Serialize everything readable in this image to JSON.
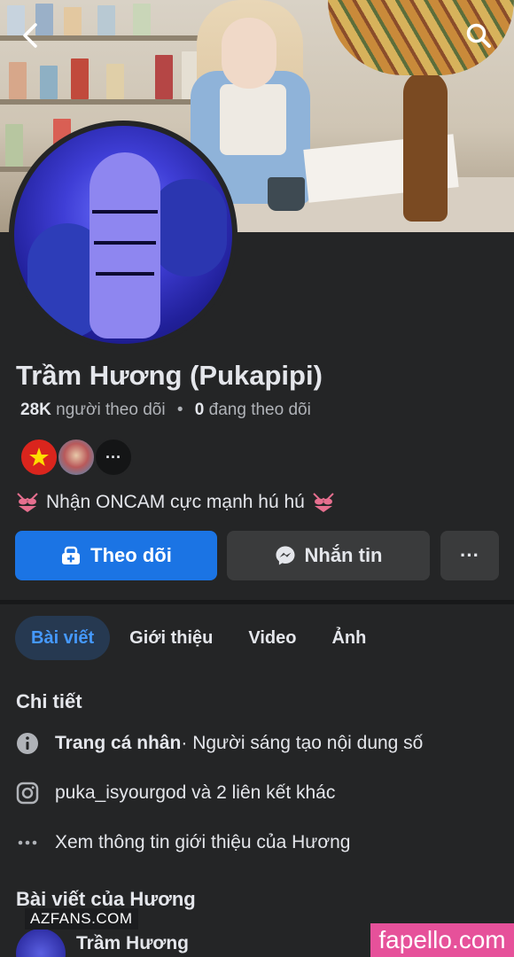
{
  "cover": {
    "alt_icons": [
      "back-arrow-icon",
      "search-icon"
    ]
  },
  "profile": {
    "name": "Trầm Hương (Pukapipi)",
    "followers_count": "28K",
    "followers_label": "người theo dõi",
    "separator": "•",
    "following_count": "0",
    "following_label": "đang theo dõi",
    "bio": "Nhận ONCAM cực mạnh hú hú"
  },
  "badges": {
    "more_label": "···"
  },
  "actions": {
    "follow_label": "Theo dõi",
    "message_label": "Nhắn tin",
    "more_label": "···"
  },
  "tabs": [
    {
      "label": "Bài viết",
      "active": true
    },
    {
      "label": "Giới thiệu",
      "active": false
    },
    {
      "label": "Video",
      "active": false
    },
    {
      "label": "Ảnh",
      "active": false
    }
  ],
  "details": {
    "title": "Chi tiết",
    "page_type_bold": "Trang cá nhân",
    "page_type_rest": " · Người sáng tạo nội dung số",
    "instagram": "puka_isyourgod và 2 liên kết khác",
    "about": "Xem thông tin giới thiệu của Hương"
  },
  "posts": {
    "title": "Bài viết của Hương",
    "author": "Trầm Hương"
  },
  "watermarks": {
    "left": "AZFANS.COM",
    "right": "fapello.com"
  },
  "colors": {
    "background": "#242526",
    "primary_button": "#1b74e4",
    "secondary_button": "#3a3b3c",
    "active_tab_bg": "#263951",
    "active_tab_text": "#4599ff",
    "watermark_pink": "#e6519a"
  }
}
